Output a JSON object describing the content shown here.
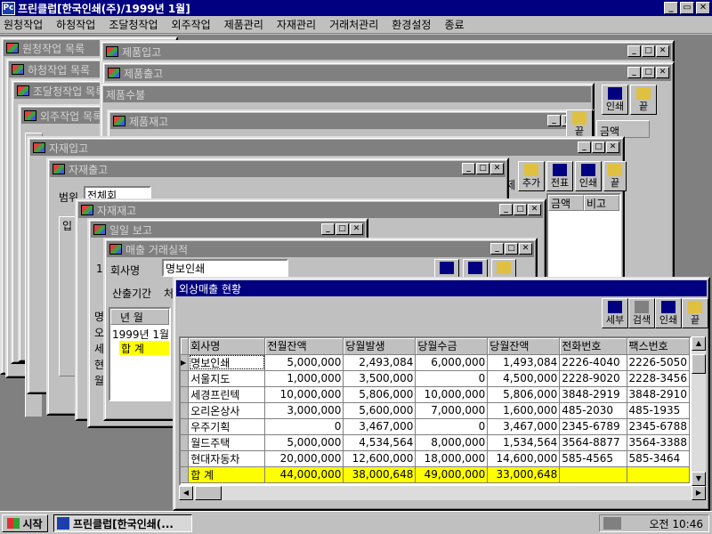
{
  "app": {
    "icon_text": "Pc",
    "title": "프린클럽[한국인쇄(주)/1999년 1월]",
    "btn_min": "_",
    "btn_restore": "▭",
    "btn_close": "✕"
  },
  "menu": [
    "원청작업",
    "하청작업",
    "조달청작업",
    "외주작업",
    "제품관리",
    "자재관리",
    "거래처관리",
    "환경설정",
    "종료"
  ],
  "bg_windows": [
    "원청작업 목록",
    "하청작업 목록",
    "조달청작업 목록",
    "외주작업 목록",
    "제품입고",
    "제품출고",
    "제품수불",
    "제품재고",
    "자재입고",
    "자재출고",
    "자재재고",
    "일일 보고",
    "매출 거래실적"
  ],
  "fragments": {
    "toolbar_print": "인쇄",
    "toolbar_end": "끝",
    "toolbar_add": "추가",
    "toolbar_slip": "전표",
    "col_amount": "금액",
    "col_remark": "비고",
    "partial_e": "제",
    "filter_range": "범위",
    "filter_range_value": "전체회",
    "col_in": "입",
    "company_label": "회사명",
    "company_value": "명보인쇄",
    "period_label": "산출기간",
    "period_value_partial": "처",
    "year_month_header": "년 월",
    "year_month_row": "1999년  1월",
    "total_label": "합  계",
    "side_chars": [
      "명",
      "오",
      "세",
      "현",
      "월"
    ],
    "num_19": "19",
    "num_2_15": [
      "2",
      "1",
      "5"
    ]
  },
  "main_window": {
    "title": "외상매출 현황",
    "buttons": [
      {
        "label": "세부",
        "icon": "detail-icon"
      },
      {
        "label": "검색",
        "icon": "search-icon"
      },
      {
        "label": "인쇄",
        "icon": "printer-icon"
      },
      {
        "label": "끝",
        "icon": "exit-icon"
      }
    ],
    "columns": [
      "회사명",
      "전월잔액",
      "당월발생",
      "당월수금",
      "당월잔액",
      "전화번호",
      "팩스번호"
    ],
    "rows": [
      [
        "명보인쇄",
        "5,000,000",
        "2,493,084",
        "6,000,000",
        "1,493,084",
        "2226-4040",
        "2226-5050"
      ],
      [
        "서울지도",
        "1,000,000",
        "3,500,000",
        "0",
        "4,500,000",
        "2228-9020",
        "2228-3456"
      ],
      [
        "세경프린텍",
        "10,000,000",
        "5,806,000",
        "10,000,000",
        "5,806,000",
        "3848-2919",
        "3848-2910"
      ],
      [
        "오리온상사",
        "3,000,000",
        "5,600,000",
        "7,000,000",
        "1,600,000",
        "485-2030",
        "485-1935"
      ],
      [
        "우주기획",
        "0",
        "3,467,000",
        "0",
        "3,467,000",
        "2345-6789",
        "2345-6788"
      ],
      [
        "월드주택",
        "5,000,000",
        "4,534,564",
        "8,000,000",
        "1,534,564",
        "3564-8877",
        "3564-3388"
      ],
      [
        "현대자동차",
        "20,000,000",
        "12,600,000",
        "18,000,000",
        "14,600,000",
        "585-4565",
        "585-3464"
      ]
    ],
    "total_row": [
      "합  계",
      "44,000,000",
      "38,000,648",
      "49,000,000",
      "33,000,648",
      "",
      ""
    ]
  },
  "taskbar": {
    "start": "시작",
    "task": "프린클럽[한국인쇄(...",
    "clock": "오전 10:46"
  }
}
